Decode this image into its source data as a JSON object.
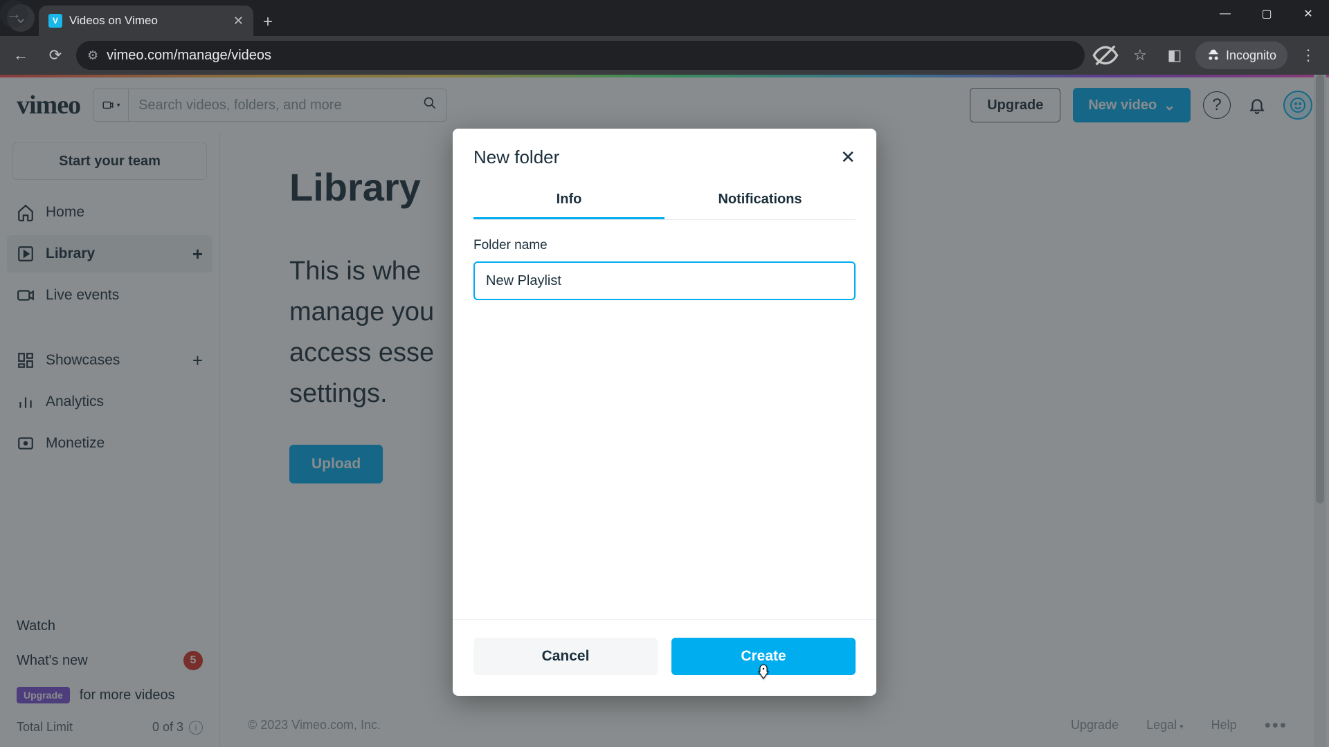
{
  "browser": {
    "tab_title": "Videos on Vimeo",
    "url": "vimeo.com/manage/videos",
    "incognito_label": "Incognito"
  },
  "header": {
    "logo_text": "vimeo",
    "search_placeholder": "Search videos, folders, and more",
    "upgrade": "Upgrade",
    "new_video": "New video"
  },
  "sidebar": {
    "start_team": "Start your team",
    "items": [
      {
        "label": "Home"
      },
      {
        "label": "Library"
      },
      {
        "label": "Live events"
      },
      {
        "label": "Showcases"
      },
      {
        "label": "Analytics"
      },
      {
        "label": "Monetize"
      }
    ],
    "watch": "Watch",
    "whats_new": "What's new",
    "whats_new_count": "5",
    "upgrade_pill": "Upgrade",
    "upgrade_text": "for more videos",
    "limit_label": "Total Limit",
    "limit_value": "0 of 3"
  },
  "main": {
    "title": "Library",
    "body_l1": "This is whe",
    "body_l2": "manage you",
    "body_l3": "access esse",
    "body_l4": "settings.",
    "upload": "Upload"
  },
  "footer": {
    "copyright": "© 2023 Vimeo.com, Inc.",
    "links": {
      "upgrade": "Upgrade",
      "legal": "Legal",
      "help": "Help"
    }
  },
  "modal": {
    "title": "New folder",
    "tab_info": "Info",
    "tab_notifications": "Notifications",
    "field_label": "Folder name",
    "field_value": "New Playlist",
    "cancel": "Cancel",
    "create": "Create"
  }
}
